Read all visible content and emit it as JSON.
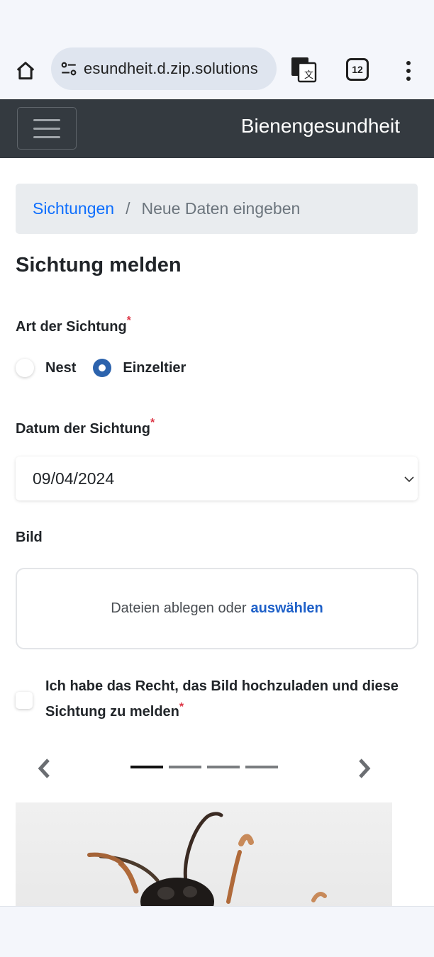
{
  "browser": {
    "url_display": "еsundheit.d.zip.solutions",
    "tab_count": "12",
    "icons": {
      "home": "home-icon",
      "site_settings": "tune-icon",
      "translate": "translate-icon",
      "tabs": "tabs-icon",
      "menu": "more-vert-icon"
    }
  },
  "navbar": {
    "brand": "Bienengesundheit",
    "toggler_icon": "hamburger-icon"
  },
  "breadcrumb": {
    "link": "Sichtungen",
    "separator": "/",
    "current": "Neue Daten eingeben"
  },
  "page": {
    "title": "Sichtung melden"
  },
  "form": {
    "required_marker": "*",
    "type": {
      "label": "Art der Sichtung",
      "options": [
        {
          "label": "Nest",
          "checked": false
        },
        {
          "label": "Einzeltier",
          "checked": true
        }
      ]
    },
    "date": {
      "label": "Datum der Sichtung",
      "value": "09/04/2024"
    },
    "image": {
      "label": "Bild",
      "dropzone_text": "Dateien ablegen oder",
      "dropzone_link": "auswählen"
    },
    "consent": {
      "text": "Ich habe das Recht, das Bild hochzuladen und diese Sichtung zu melden",
      "checked": false
    }
  },
  "carousel": {
    "slide_count": 4,
    "active_index": 0
  },
  "colors": {
    "navbar_bg": "#343a40",
    "link": "#0d6efd",
    "radio_checked": "#2c63ad",
    "required": "#dc3545"
  }
}
